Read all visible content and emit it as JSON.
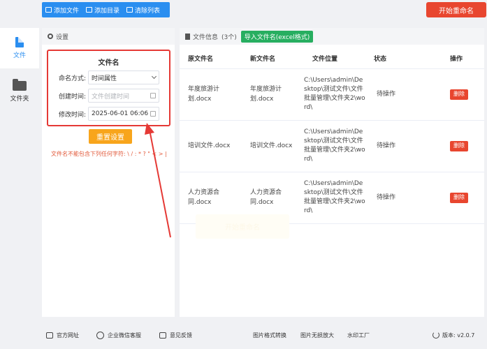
{
  "toolbar": {
    "add_file": "添加文件",
    "add_dir": "添加目录",
    "clear_list": "清除列表",
    "start_rename": "开始重命名"
  },
  "sidebar": {
    "items": [
      {
        "label": "文件",
        "icon": "file-icon",
        "active": true
      },
      {
        "label": "文件夹",
        "icon": "folder-icon",
        "active": false
      }
    ]
  },
  "settings": {
    "title": "设置",
    "form_title": "文件名",
    "naming_label": "命名方式:",
    "naming_value": "时间属性",
    "created_label": "创建时间:",
    "created_placeholder": "文件创建时间",
    "modified_label": "修改时间:",
    "modified_value": "2025-06-01 06:06",
    "reset": "重置设置",
    "warning": "文件名不能包含下列任何字符: \\ / : * ? \" < > |"
  },
  "file_list": {
    "title": "文件信息",
    "count": "(3个)",
    "import_btn": "导入文件名(excel格式)",
    "columns": [
      "原文件名",
      "新文件名",
      "文件位置",
      "状态",
      "操作"
    ],
    "rows": [
      {
        "orig": "年度旅游计划.docx",
        "new": "年度旅游计划.docx",
        "path": "C:\\Users\\admin\\Desktop\\测试文件\\文件批量管理\\文件夹2\\word\\",
        "status": "待操作",
        "action": "删除"
      },
      {
        "orig": "培训文件.docx",
        "new": "培训文件.docx",
        "path": "C:\\Users\\admin\\Desktop\\测试文件\\文件批量管理\\文件夹2\\word\\",
        "status": "待操作",
        "action": "删除"
      },
      {
        "orig": "人力资源合同.docx",
        "new": "人力资源合同.docx",
        "path": "C:\\Users\\admin\\Desktop\\测试文件\\文件批量管理\\文件夹2\\word\\",
        "status": "待操作",
        "action": "删除"
      }
    ]
  },
  "footer": {
    "website": "官方网址",
    "wechat": "企业微信客服",
    "feedback": "意见反馈",
    "img_convert": "图片格式转换",
    "img_enlarge": "图片无损放大",
    "watermark": "水印工厂",
    "version": "版本: v2.0.7"
  },
  "colors": {
    "primary": "#2a8ef0",
    "danger": "#e8462f",
    "warning": "#f8a51c",
    "success": "#27ae60",
    "highlight": "#e53935"
  }
}
